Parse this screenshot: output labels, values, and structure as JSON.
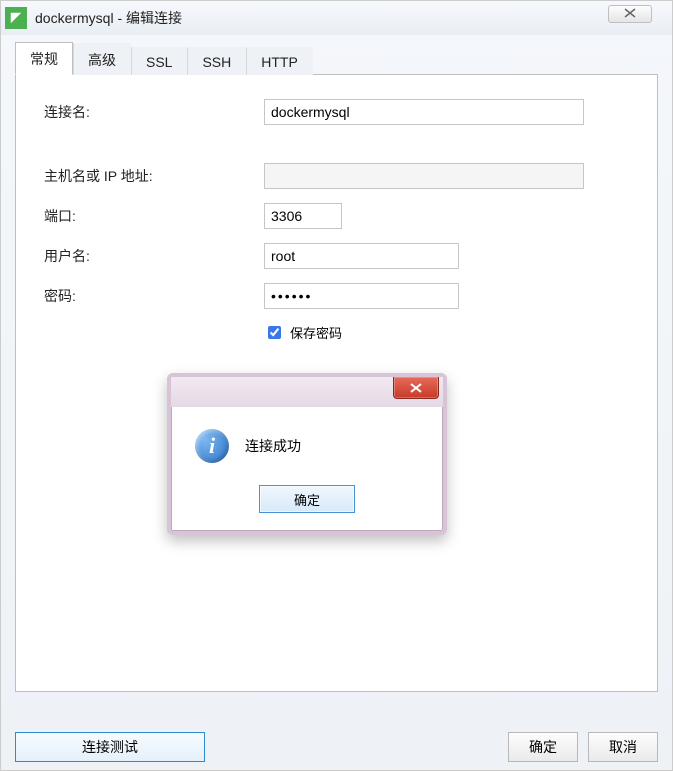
{
  "window": {
    "title": "dockermysql - 编辑连接"
  },
  "tabs": [
    "常规",
    "高级",
    "SSL",
    "SSH",
    "HTTP"
  ],
  "form": {
    "connection_name_label": "连接名:",
    "connection_name_value": "dockermysql",
    "host_label": "主机名或 IP 地址:",
    "host_value": "",
    "port_label": "端口:",
    "port_value": "3306",
    "username_label": "用户名:",
    "username_value": "root",
    "password_label": "密码:",
    "password_value": "••••••",
    "save_password_label": "保存密码"
  },
  "footer": {
    "test_label": "连接测试",
    "ok_label": "确定",
    "cancel_label": "取消"
  },
  "dialog": {
    "message": "连接成功",
    "ok_label": "确定"
  }
}
